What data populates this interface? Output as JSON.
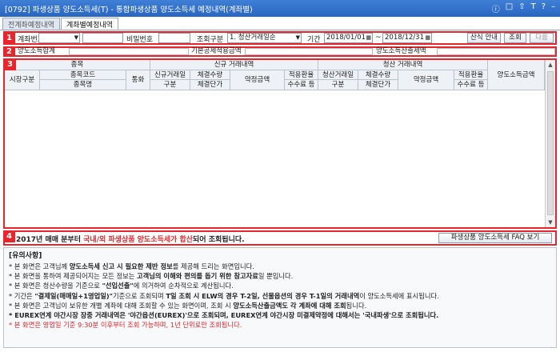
{
  "window": {
    "title": "[0792] 파생상품 양도소득세(T) - 통합파생상품 양도소득세 예정내역(계좌별)",
    "controls": [
      "ⓘ",
      "□",
      "⇧",
      "T",
      "?",
      "–"
    ]
  },
  "tabs": [
    {
      "label": "전계좌예정내역",
      "active": false
    },
    {
      "label": "계좌별예정내역",
      "active": true
    }
  ],
  "search": {
    "account_label": "계좌번호",
    "password_label": "비밀번호",
    "query_type_label": "조회구분",
    "query_type_value": "1. 청산거래일순",
    "period_label": "기간",
    "date_from": "2018/01/01",
    "date_sep": "~",
    "date_to": "2018/12/31",
    "btn_calc": "산식 안내",
    "btn_query": "조회",
    "btn_next": "다음"
  },
  "summary": {
    "total_label": "양도소득합계",
    "deduction_label": "기본공제적용금액",
    "tax_label": "양도소득산출세액"
  },
  "grid": {
    "h_item": "종목",
    "h_new": "신규 거래내역",
    "h_close": "청산 거래내역",
    "h_market": "시장구분",
    "h_code": "종목코드",
    "h_name": "종목명",
    "h_currency": "통화",
    "h_new_date": "신규거래일",
    "h_div": "구분",
    "h_qty": "체결수량",
    "h_price": "체결단가",
    "h_amount": "약정금액",
    "h_fx": "적용환율",
    "h_fee": "수수료 등",
    "h_close_date": "청산거래일",
    "h_div2": "구분",
    "h_qty2": "체결수량",
    "h_price2": "체결단가",
    "h_amount2": "약정금액",
    "h_fx2": "적용환율",
    "h_fee2": "수수료 등",
    "h_gain": "양도소득금액"
  },
  "banner": {
    "p1": "2017년 매매 분부터 ",
    "p2": "국내/외 파생상품 양도소득세가 합산",
    "p3": "되어 조회됩니다.",
    "faq": "파생상품 양도소득세 FAQ 보기"
  },
  "notice": {
    "title": "[유의사항]",
    "l1a": "* 본 화면은 고객님께 ",
    "l1b": "양도소득세 신고 시 필요한 제반 정보",
    "l1c": "를 제공해 드리는 화면입니다.",
    "l2a": "* 본 화면을 통하여 제공되어지는 모든 정보는 ",
    "l2b": "고객님의 이해와 편의를 돕기 위한 참고자료",
    "l2c": "일 뿐입니다.",
    "l3a": "* 본 화면은 청산수량을 기준으로 ",
    "l3b": "\"선입선출\"",
    "l3c": "에 의거하여 순차적으로 계산됩니다.",
    "l4a": "* 기간은 ",
    "l4b": "\"결제일(매매일+1영업일)\"",
    "l4c": "기준으로 조회되며 ",
    "l4d": "T일 조회 시 ELW의 경우 T-2일, 선물옵션의 경우 T-1일의 거래내역",
    "l4e": "이 양도소득세에 표시됩니다.",
    "l5a": "* 본 화면은 고객님이 보유한 개별 계좌에 대해 조회할 수 있는 화면이며, 조회 시 ",
    "l5b": "양도소득산출금액도 각 계좌에 대해 조회",
    "l5c": "됩니다.",
    "l6": "* EUREX연계 야간시장 장중 거래내역은 '야간옵션(EUREX)'으로 조회되며, EUREX연계 야간시장 미결제약정에 대해서는 '국내파생'으로 조회됩니다.",
    "l7": "* 본 화면은 영업일 기준 9:30분 이후부터 조회 가능하며, 1년 단위로만 조회됩니다."
  },
  "section_numbers": [
    "1",
    "2",
    "3",
    "4"
  ]
}
